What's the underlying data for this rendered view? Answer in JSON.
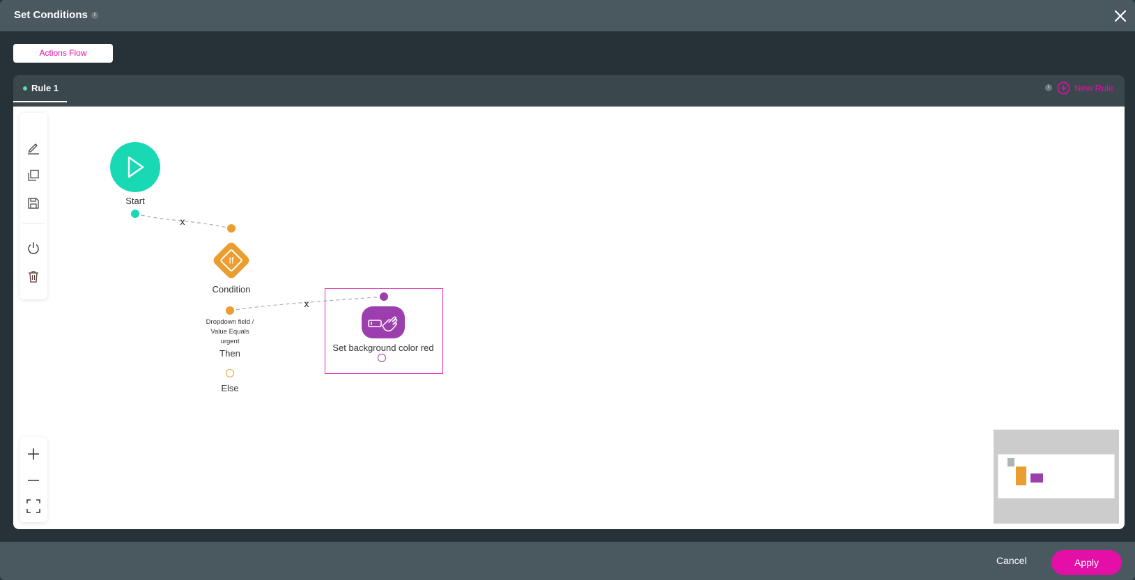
{
  "dialog": {
    "title": "Set Conditions",
    "info_icon": "info-icon",
    "close_icon": "close-icon"
  },
  "tabs": [
    {
      "label": "Actions Flow",
      "active": true
    }
  ],
  "rules": {
    "tabs": [
      {
        "label": "Rule 1",
        "active": true,
        "status_color": "#5ddba8"
      }
    ],
    "new_rule_label": "New Rule",
    "new_rule_icon": "plus-circle-icon"
  },
  "toolbar": {
    "top": [
      {
        "name": "edit",
        "icon": "pencil-icon"
      },
      {
        "name": "duplicate",
        "icon": "copy-icon"
      },
      {
        "name": "save",
        "icon": "save-icon"
      },
      {
        "name": "toggle",
        "icon": "power-icon"
      },
      {
        "name": "delete",
        "icon": "trash-icon"
      }
    ],
    "zoom": [
      {
        "name": "zoom-in",
        "icon": "plus-icon"
      },
      {
        "name": "zoom-out",
        "icon": "minus-icon"
      },
      {
        "name": "fit-view",
        "icon": "fit-screen-icon"
      }
    ]
  },
  "flow": {
    "start": {
      "label": "Start",
      "color": "#19d9b4",
      "icon": "play-icon"
    },
    "condition": {
      "label": "Condition",
      "icon_text": "If",
      "color": "#eb9d2f",
      "description_lines": [
        "Dropdown field /",
        "Value Equals",
        "urgent"
      ],
      "then_label": "Then",
      "else_label": "Else"
    },
    "action": {
      "label": "Set background color red",
      "color": "#9c3ead",
      "icon": "click-button-icon",
      "selected": true
    },
    "edges": [
      {
        "from": "start",
        "to": "condition",
        "remove_label": "x"
      },
      {
        "from": "condition.then",
        "to": "action",
        "remove_label": "x"
      }
    ]
  },
  "minimap": {
    "colors": {
      "start": "#b0b3b5",
      "condition": "#eb9d2f",
      "action": "#9c3ead"
    }
  },
  "footer": {
    "cancel_label": "Cancel",
    "apply_label": "Apply",
    "accent": "#e30fa6"
  }
}
